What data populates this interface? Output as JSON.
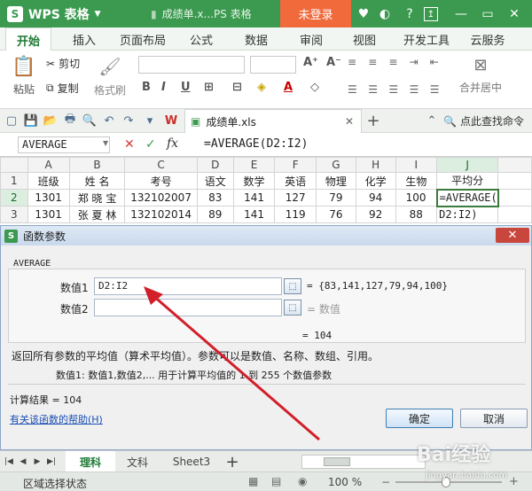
{
  "titlebar": {
    "app_name": "WPS 表格",
    "doc_title": "成绩单.x...PS 表格",
    "login": "未登录"
  },
  "ribbon": {
    "tabs": [
      "开始",
      "插入",
      "页面布局",
      "公式",
      "数据",
      "审阅",
      "视图",
      "开发工具",
      "云服务"
    ],
    "active_tab": "开始",
    "paste": "粘贴",
    "cut": "剪切",
    "copy": "复制",
    "format_painter": "格式刷",
    "merge_center": "合并居中"
  },
  "qat": {
    "doc_tab": "成绩单.xls",
    "search": "点此查找命令"
  },
  "formula_bar": {
    "name_box": "AVERAGE",
    "fx": "fx",
    "formula": "=AVERAGE(D2:I2)"
  },
  "grid": {
    "columns": [
      "A",
      "B",
      "C",
      "D",
      "E",
      "F",
      "G",
      "H",
      "I",
      "J"
    ],
    "rows": [
      {
        "num": "1",
        "cells": [
          "班级",
          "姓 名",
          "考号",
          "语文",
          "数学",
          "英语",
          "物理",
          "化学",
          "生物",
          "平均分"
        ]
      },
      {
        "num": "2",
        "cells": [
          "1301",
          "郑 晓 宝",
          "132102007",
          "83",
          "141",
          "127",
          "79",
          "94",
          "100",
          "=AVERAGE("
        ]
      },
      {
        "num": "3",
        "cells": [
          "1301",
          "张 夏 林",
          "132102014",
          "89",
          "141",
          "119",
          "76",
          "92",
          "88",
          "D2:I2)"
        ]
      }
    ]
  },
  "dialog": {
    "title": "函数参数",
    "function_name": "AVERAGE",
    "arg1_label": "数值1",
    "arg1_value": "D2:I2",
    "arg1_result": "= {83,141,127,79,94,100}",
    "arg2_label": "数值2",
    "arg2_result": "= 数值",
    "preview": "= 104",
    "description": "返回所有参数的平均值（算术平均值）。参数可以是数值、名称、数组、引用。",
    "arg_help": "数值1:  数值1,数值2,... 用于计算平均值的 1 到 255 个数值参数",
    "result_label": "计算结果 = 104",
    "help_link": "有关该函数的帮助(H)",
    "ok": "确定",
    "cancel": "取消"
  },
  "sheets": {
    "tabs": [
      "理科",
      "文科",
      "Sheet3"
    ],
    "active": "理科"
  },
  "status": {
    "mode": "区域选择状态",
    "zoom": "100 %"
  },
  "watermark": {
    "text": "Bai经验",
    "url": "jingyan.baidu.com"
  },
  "colors": {
    "accent": "#3b9a4f",
    "login": "#f06a3c",
    "arrow": "#d21f2a"
  }
}
